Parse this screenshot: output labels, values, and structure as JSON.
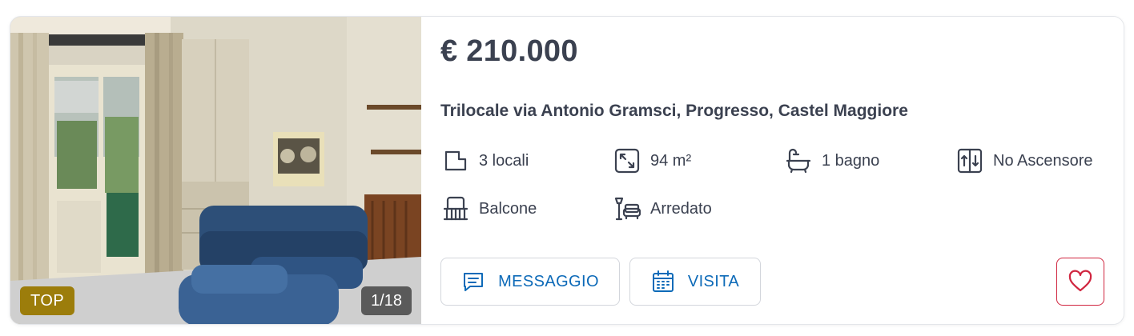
{
  "listing": {
    "price": "€ 210.000",
    "title": "Trilocale via Antonio Gramsci, Progresso, Castel Maggiore",
    "badge": "TOP",
    "photo_counter": "1/18",
    "features": [
      {
        "icon": "rooms-icon",
        "label": "3 locali"
      },
      {
        "icon": "area-icon",
        "label": "94 m²"
      },
      {
        "icon": "bathtub-icon",
        "label": "1 bagno"
      },
      {
        "icon": "elevator-icon",
        "label": "No Ascensore"
      },
      {
        "icon": "balcony-icon",
        "label": "Balcone"
      },
      {
        "icon": "furnished-icon",
        "label": "Arredato"
      }
    ]
  },
  "actions": {
    "message_label": "MESSAGGIO",
    "visit_label": "VISITA",
    "favorite_icon": "heart-icon"
  },
  "colors": {
    "accent": "#0d6ab8",
    "badge": "#9c7d0b",
    "favorite": "#d0253f",
    "text": "#3b4150"
  }
}
